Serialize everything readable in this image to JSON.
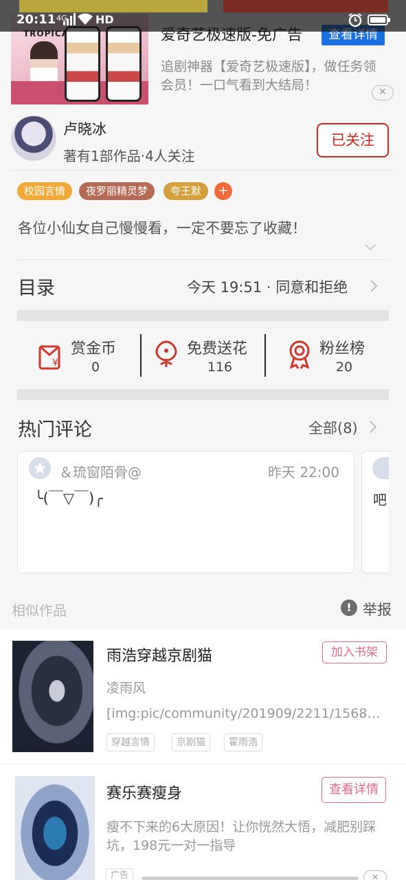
{
  "status_bar": {
    "time": "20:11",
    "network": "4G",
    "hd_label": "HD"
  },
  "ad_banner": {
    "thumb_text": "TROPICAL",
    "title": "爱奇艺极速版-免广告",
    "detail_button": "查看详情",
    "description": "追剧神器【爱奇艺极速版】，做任务领会员！一口气看到大结局！",
    "close_symbol": "✕"
  },
  "author": {
    "name": "卢晓冰",
    "meta": "著有1部作品·4人关注",
    "follow_button": "已关注"
  },
  "tags": [
    {
      "label": "校园言情",
      "color": "#f2a935"
    },
    {
      "label": "夜罗丽精灵梦",
      "color": "#b56a55"
    },
    {
      "label": "夸王默",
      "color": "#d4a03c"
    }
  ],
  "tag_add": "+",
  "description": "各位小仙女自己慢慢看，一定不要忘了收藏！",
  "catalog": {
    "label": "目录",
    "latest": "今天 19:51 · 同意和拒绝"
  },
  "stats": [
    {
      "label": "赏金币",
      "value": "0",
      "icon": "red-envelope-icon"
    },
    {
      "label": "免费送花",
      "value": "116",
      "icon": "flower-icon"
    },
    {
      "label": "粉丝榜",
      "value": "20",
      "icon": "medal-icon"
    }
  ],
  "comments": {
    "title": "热门评论",
    "all_link": "全部(8)",
    "items": [
      {
        "user": "＆琉窗陌骨@",
        "time": "昨天 22:00",
        "text": "╰(￣▽￣)╭"
      },
      {
        "text": "吧"
      }
    ]
  },
  "similar": {
    "label": "相似作品",
    "report": "举报",
    "report_icon": "!"
  },
  "list": [
    {
      "title": "雨浩穿越京剧猫",
      "author": "凌雨风",
      "intro": "[img:pic/community/201909/2211/1568…",
      "tags": [
        "穿越言情",
        "京剧猫",
        "霍雨浩"
      ],
      "button": "加入书架"
    },
    {
      "title": "赛乐赛瘦身",
      "description": "瘦不下来的6大原因！让你恍然大悟，减肥别踩坑，198元一对一指导",
      "button": "查看详情",
      "ad_tag": "广告",
      "close_symbol": "✕"
    }
  ],
  "colors": {
    "accent_red": "#c8281e",
    "pink_button": "#e06b8a",
    "ad_blue": "#1c6fe0"
  }
}
